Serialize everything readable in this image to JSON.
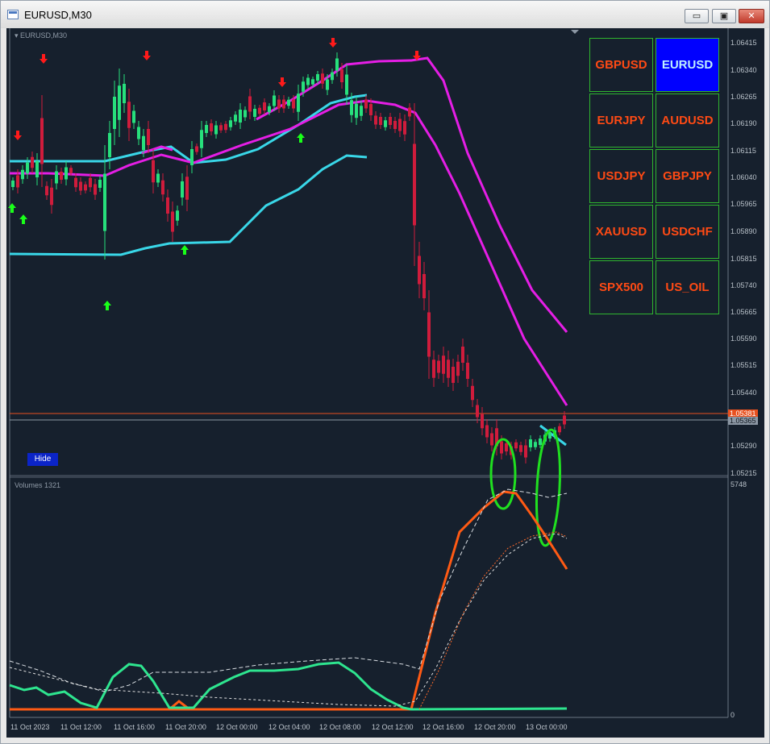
{
  "window": {
    "title": "EURUSD,M30",
    "controls": {
      "minimize": "▭",
      "restore": "▣",
      "close": "✕"
    }
  },
  "chart": {
    "main_label": "EURUSD,M30",
    "volumes_label": "Volumes 1321",
    "hide_button": "Hide",
    "price_axis": [
      "1.06415",
      "1.06340",
      "1.06265",
      "1.06190",
      "1.06115",
      "1.06040",
      "1.05965",
      "1.05890",
      "1.05815",
      "1.05740",
      "1.05665",
      "1.05590",
      "1.05515",
      "1.05440",
      "1.05290",
      "1.05215"
    ],
    "price_tags": {
      "bid": "1.05381",
      "current": "1.05365"
    },
    "volume_axis": {
      "max": "5748",
      "zero": "0"
    },
    "time_axis": [
      "11 Oct 2023",
      "11 Oct 12:00",
      "11 Oct 16:00",
      "11 Oct 20:00",
      "12 Oct 00:00",
      "12 Oct 04:00",
      "12 Oct 08:00",
      "12 Oct 12:00",
      "12 Oct 16:00",
      "12 Oct 20:00",
      "13 Oct 00:00"
    ],
    "colors": {
      "background": "#16202d",
      "bull": "#27e07c",
      "bear": "#d01c3c",
      "envelope": "#e51ee5",
      "trend": "#39d7e8",
      "buy_arrow": "#19ff19",
      "sell_arrow": "#ff1a1a",
      "highlight": "#20e020"
    }
  },
  "symbols": [
    {
      "label": "GBPUSD",
      "active": false
    },
    {
      "label": "EURUSD",
      "active": true
    },
    {
      "label": "EURJPY",
      "active": false
    },
    {
      "label": "AUDUSD",
      "active": false
    },
    {
      "label": "USDJPY",
      "active": false
    },
    {
      "label": "GBPJPY",
      "active": false
    },
    {
      "label": "XAUUSD",
      "active": false
    },
    {
      "label": "USDCHF",
      "active": false
    },
    {
      "label": "SPX500",
      "active": false
    },
    {
      "label": "US_OIL",
      "active": false
    }
  ]
}
